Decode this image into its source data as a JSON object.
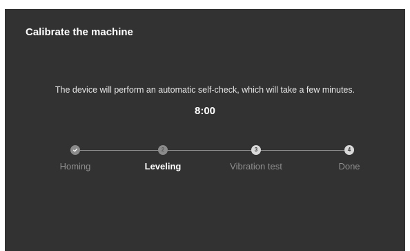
{
  "dialog": {
    "title": "Calibrate the machine",
    "description": "The device will perform an automatic self-check, which will take a few minutes.",
    "timer": "8:00"
  },
  "steps": [
    {
      "number": "",
      "icon": "check-icon",
      "label": "Homing",
      "state": "done"
    },
    {
      "number": "2",
      "label": "Leveling",
      "state": "current"
    },
    {
      "number": "3",
      "label": "Vibration test",
      "state": "pending"
    },
    {
      "number": "4",
      "label": "Done",
      "state": "pending"
    }
  ],
  "current_step": 2,
  "total_steps": 4,
  "colors": {
    "background": "#323232",
    "text": "#ffffff",
    "muted": "#8f8f8f"
  }
}
